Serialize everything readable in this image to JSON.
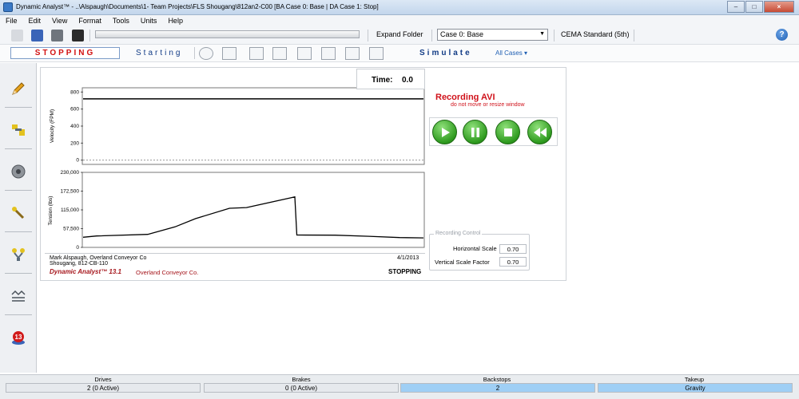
{
  "window": {
    "title": "Dynamic Analyst™ - ..\\Alspaugh\\Documents\\1- Team Projects\\FLS Shougang\\812an2-C00 [BA Case 0: Base | DA Case 1: Stop]"
  },
  "menu": [
    "File",
    "Edit",
    "View",
    "Format",
    "Tools",
    "Units",
    "Help"
  ],
  "toolbar": {
    "expand_label": "Expand Folder",
    "case_value": "Case 0: Base",
    "standard_label": "CEMA Standard (5th)",
    "help_label": "?"
  },
  "modes": {
    "stopping": "STOPPING",
    "starting": "Starting",
    "simulate": "Simulate",
    "all_cases": "All Cases ▾",
    "graph_buttons": [
      "Animate",
      "Tension",
      "Speed",
      "Power",
      "Torque",
      "Slip",
      "Takeup",
      "Sag"
    ]
  },
  "sidebar": [
    {
      "name": "pencil-icon"
    },
    {
      "name": "drives-icon"
    },
    {
      "name": "pulley-icon"
    },
    {
      "name": "brake-icon"
    },
    {
      "name": "takeup-icon"
    },
    {
      "name": "belt-icon"
    },
    {
      "name": "version-13-icon",
      "badge": "13"
    }
  ],
  "playback": {
    "time_label": "Time:",
    "time_value": "0.0",
    "recording_title": "Recording AVI",
    "recording_note": "do not move or resize window",
    "buttons": [
      "play-button",
      "pause-button",
      "stop-button",
      "rewind-button"
    ]
  },
  "recording_control": {
    "legend": "Recording Control",
    "h_label": "Horizontal Scale",
    "h_value": "0.70",
    "v_label": "Vertical Scale Factor",
    "v_value": "0.70"
  },
  "report": {
    "author_line": "Mark Alspaugh,  Overland Conveyor Co",
    "project_line": "Shougang,  812-CB-110",
    "date": "4/1/2013",
    "brand": "Dynamic Analyst™ 13.1",
    "company": "Overland Conveyor Co.",
    "mode": "STOPPING"
  },
  "chart_data": [
    {
      "type": "line",
      "ylabel": "Velocity (FPM)",
      "yticks": [
        "800",
        "600",
        "400",
        "200",
        "0"
      ],
      "ylim": [
        -50,
        850
      ],
      "series": [
        {
          "values": [
            [
              0,
              720
            ],
            [
              1,
              720
            ]
          ]
        },
        {
          "values": [
            [
              0,
              0
            ],
            [
              1,
              0
            ]
          ]
        }
      ]
    },
    {
      "type": "line",
      "ylabel": "Tension (lbs)",
      "yticks": [
        "230,000",
        "172,500",
        "115,000",
        "57,500",
        "0"
      ],
      "ylim": [
        0,
        230000
      ],
      "series": [
        {
          "values": [
            [
              0,
              31000
            ],
            [
              0.04,
              35000
            ],
            [
              0.19,
              40000
            ],
            [
              0.27,
              63000
            ],
            [
              0.33,
              88000
            ],
            [
              0.43,
              120000
            ],
            [
              0.48,
              122000
            ],
            [
              0.61,
              152000
            ],
            [
              0.622,
              155000
            ],
            [
              0.628,
              38000
            ],
            [
              0.74,
              37500
            ],
            [
              0.84,
              34000
            ],
            [
              0.93,
              30000
            ],
            [
              1,
              29000
            ]
          ]
        }
      ]
    }
  ],
  "status": [
    {
      "head": "Drives",
      "value": "2 (0 Active)",
      "color": "#e6e9ed"
    },
    {
      "head": "Brakes",
      "value": "0 (0 Active)",
      "color": "#e6e9ed"
    },
    {
      "head": "Backstops",
      "value": "2",
      "color": "#9fcff5"
    },
    {
      "head": "Takeup",
      "value": "Gravity",
      "color": "#9fcff5"
    }
  ]
}
